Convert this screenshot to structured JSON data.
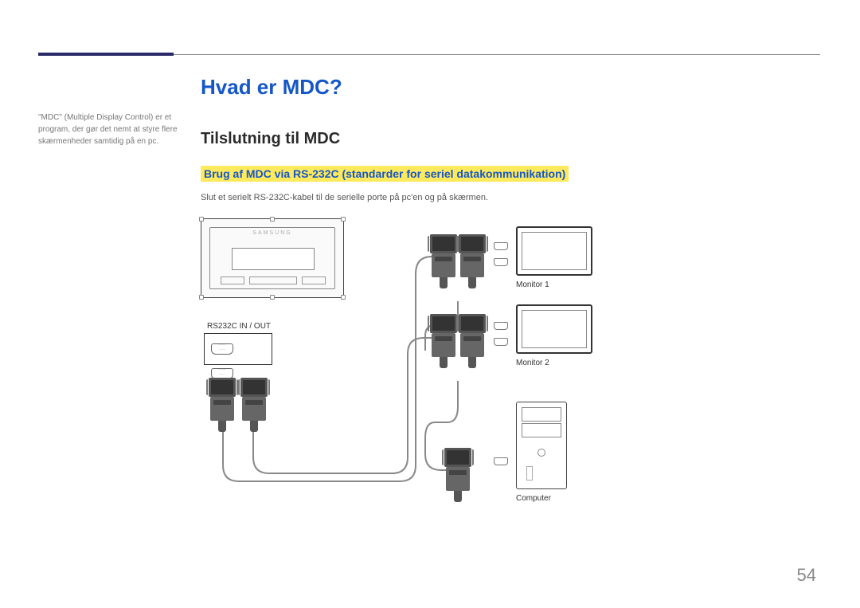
{
  "page_number": "54",
  "side_note": "\"MDC\" (Multiple Display Control) er et program, der gør det nemt at styre flere skærmenheder samtidig på en pc.",
  "heading_h1": "Hvad er MDC?",
  "heading_h2": "Tilslutning til MDC",
  "heading_h3": "Brug af MDC via RS-232C (standarder for seriel datakommunikation)",
  "body_text": "Slut et serielt RS-232C-kabel til de serielle porte på pc'en og på skærmen.",
  "diagram": {
    "display_brand": "SAMSUNG",
    "port_label": "RS232C IN / OUT",
    "labels": {
      "monitor1": "Monitor 1",
      "monitor2": "Monitor 2",
      "computer": "Computer"
    }
  }
}
